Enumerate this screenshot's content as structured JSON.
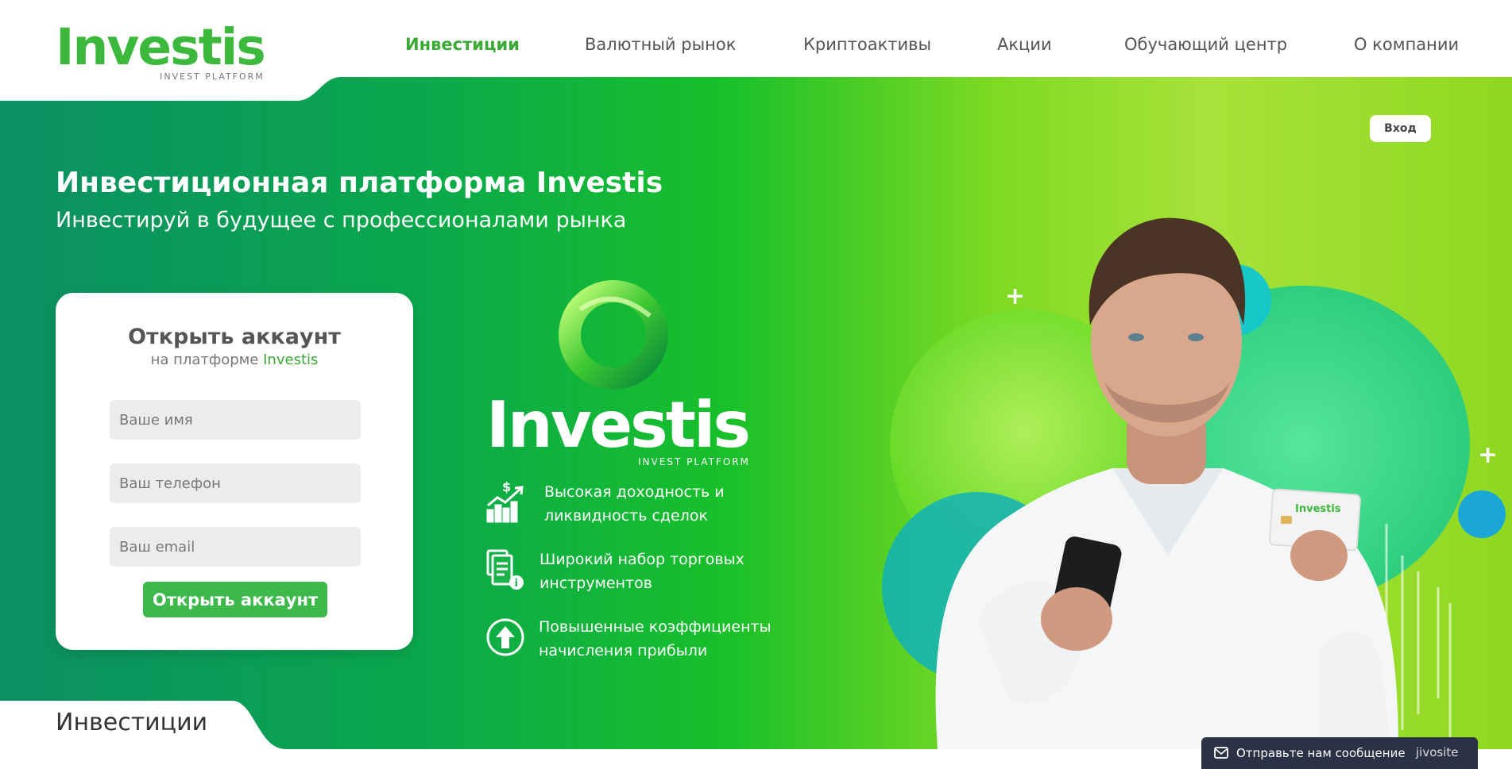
{
  "header": {
    "logo_text": "Investis",
    "logo_sub": "INVEST PLATFORM",
    "nav": [
      {
        "label": "Инвестиции",
        "active": true
      },
      {
        "label": "Валютный рынок",
        "active": false
      },
      {
        "label": "Криптоактивы",
        "active": false
      },
      {
        "label": "Акции",
        "active": false
      },
      {
        "label": "Обучающий центр",
        "active": false
      },
      {
        "label": "О компании",
        "active": false
      }
    ]
  },
  "hero": {
    "login_label": "Вход",
    "title": "Инвестиционная платформа Investis",
    "subtitle": "Инвестируй в будущее с профессионалами рынка",
    "brand_text": "Investis",
    "brand_sub": "INVEST PLATFORM",
    "features": [
      {
        "icon": "growth-chart-icon",
        "text": "Высокая доходность и ликвидность сделок"
      },
      {
        "icon": "documents-info-icon",
        "text": "Широкий набор торговых инструментов"
      },
      {
        "icon": "arrow-up-circle-icon",
        "text": "Повышенные коэффициенты начисления прибыли"
      }
    ],
    "card_brand": "Investis"
  },
  "form": {
    "title": "Открыть аккаунт",
    "subtitle_prefix": "на платформе",
    "subtitle_brand": "Investis",
    "name_placeholder": "Ваше имя",
    "phone_placeholder": "Ваш телефон",
    "email_placeholder": "Ваш email",
    "submit_label": "Открыть аккаунт"
  },
  "section": {
    "title": "Инвестиции"
  },
  "chat": {
    "label": "Отправьте нам сообщение",
    "brand": "jivosite"
  },
  "colors": {
    "brand_green": "#3cb93c",
    "accent_green": "#3aaa35",
    "chat_bg": "#2c3246"
  }
}
